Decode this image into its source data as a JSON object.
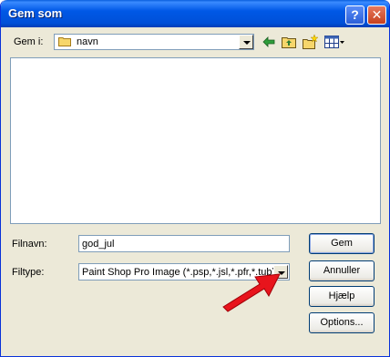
{
  "window": {
    "title": "Gem som",
    "help_glyph": "?",
    "close_glyph": "✕"
  },
  "location": {
    "label": "Gem i:",
    "value": "navn"
  },
  "toolbar": {
    "icons": [
      "back-arrow-icon",
      "up-folder-icon",
      "new-folder-icon",
      "view-menu-icon"
    ]
  },
  "form": {
    "filename_label": "Filnavn:",
    "filename_value": "god_jul",
    "filetype_label": "Filtype:",
    "filetype_value": "Paint Shop Pro Image (*.psp,*.jsl,*.pfr,*.tub)"
  },
  "buttons": {
    "save": "Gem",
    "cancel": "Annuller",
    "help": "Hjælp",
    "options": "Options..."
  },
  "colors": {
    "titlebar": "#0058E6",
    "window_bg": "#ECE9D8",
    "arrow": "#E8141C"
  }
}
